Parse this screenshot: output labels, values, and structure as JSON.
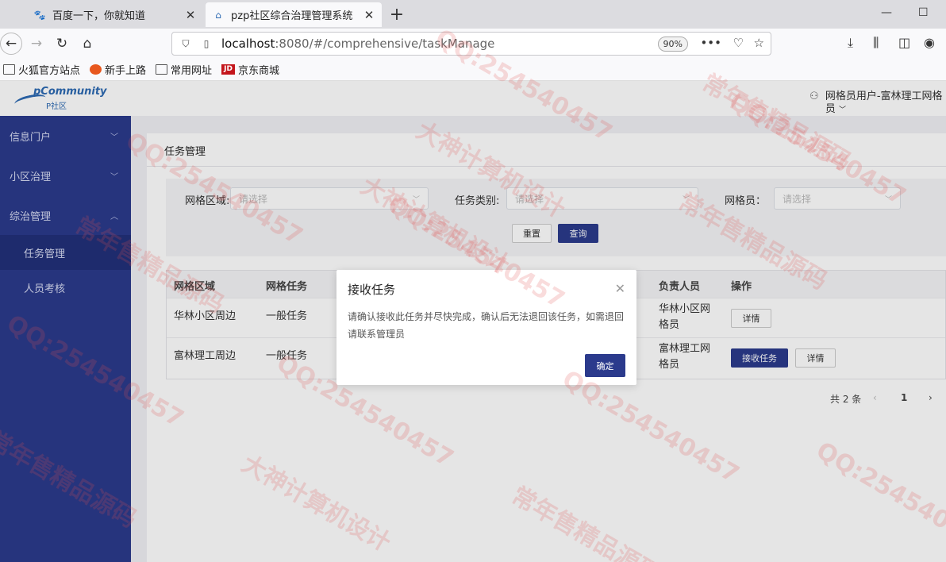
{
  "browser": {
    "tabs": [
      {
        "label": "百度一下，你就知道",
        "icon": "baidu-paw-icon"
      },
      {
        "label": "pzp社区综合治理管理系统",
        "icon": "home-icon"
      }
    ],
    "url_prefix": "localhost",
    "url_rest": ":8080/#/comprehensive/taskManage",
    "zoom": "90%",
    "bookmarks": [
      {
        "label": "火狐官方站点",
        "icon": "folder-icon"
      },
      {
        "label": "新手上路",
        "icon": "firefox-icon"
      },
      {
        "label": "常用网址",
        "icon": "folder-icon"
      },
      {
        "label": "京东商城",
        "icon": "jd-icon"
      }
    ]
  },
  "app": {
    "logo_text": "pCommunity",
    "logo_sub": "P社区",
    "user": "网格员用户-富林理工网格员",
    "sidebar": {
      "menus": [
        {
          "label": "信息门户"
        },
        {
          "label": "小区治理"
        },
        {
          "label": "综治管理"
        }
      ],
      "subitems": [
        {
          "label": "任务管理"
        },
        {
          "label": "人员考核"
        }
      ]
    },
    "page_title": "任务管理",
    "filters": {
      "area_label": "网格区域:",
      "type_label": "任务类别:",
      "member_label": "网格员：",
      "placeholder": "请选择",
      "reset": "重置",
      "query": "查询"
    },
    "table": {
      "headers": [
        "网格区域",
        "网格任务",
        "负责人员",
        "操作"
      ],
      "rows": [
        {
          "area": "华林小区周边",
          "task": "一般任务",
          "person": "华林小区网格员",
          "actions": [
            "详情"
          ]
        },
        {
          "area": "富林理工周边",
          "task": "一般任务",
          "person": "富林理工网格员",
          "actions": [
            "接收任务",
            "详情"
          ]
        }
      ]
    },
    "pagination": {
      "total": "共 2 条",
      "page": "1"
    }
  },
  "dialog": {
    "title": "接收任务",
    "message": "请确认接收此任务并尽快完成，确认后无法退回该任务，如需退回请联系管理员",
    "confirm": "确定"
  },
  "watermark": {
    "lines": [
      "QQ:254540457",
      "常年售精品源码",
      "大神计算机设计"
    ],
    "color": "#e25050"
  }
}
